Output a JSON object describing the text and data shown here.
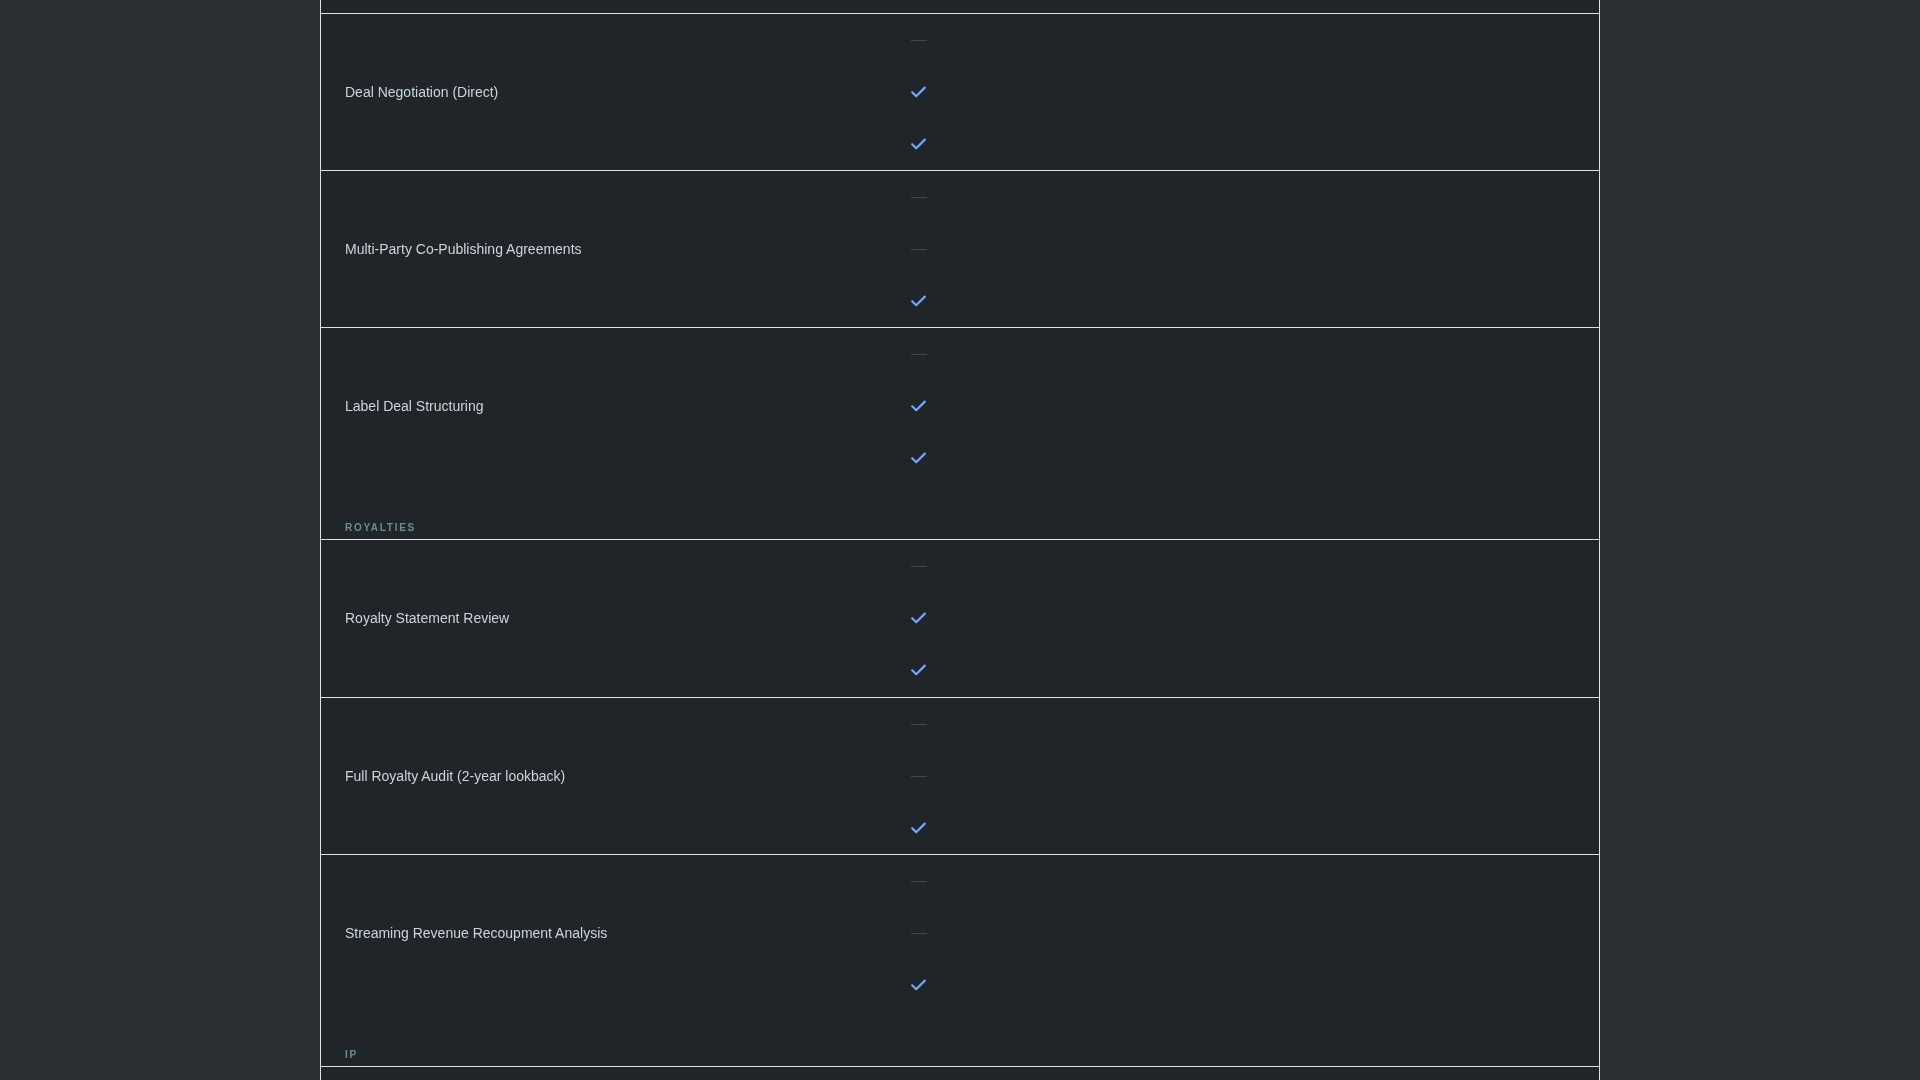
{
  "rows": [
    {
      "kind": "feature",
      "name": "Deal Negotiation (Direct)",
      "tiers": [
        {
          "included": false
        },
        {
          "included": true
        },
        {
          "included": true
        }
      ]
    },
    {
      "kind": "feature",
      "name": "Multi-Party Co-Publishing Agreements",
      "tiers": [
        {
          "included": false
        },
        {
          "included": false
        },
        {
          "included": true
        }
      ]
    },
    {
      "kind": "feature",
      "name": "Label Deal Structuring",
      "tiers": [
        {
          "included": false
        },
        {
          "included": true
        },
        {
          "included": true
        }
      ]
    },
    {
      "kind": "section",
      "title": "ROYALTIES"
    },
    {
      "kind": "feature",
      "name": "Royalty Statement Review",
      "tiers": [
        {
          "included": false
        },
        {
          "included": true
        },
        {
          "included": true
        }
      ]
    },
    {
      "kind": "feature",
      "name": "Full Royalty Audit (2-year lookback)",
      "tiers": [
        {
          "included": false
        },
        {
          "included": false
        },
        {
          "included": true
        }
      ]
    },
    {
      "kind": "feature",
      "name": "Streaming Revenue Recoupment Analysis",
      "tiers": [
        {
          "included": false
        },
        {
          "included": false
        },
        {
          "included": true
        }
      ]
    },
    {
      "kind": "section",
      "title": "IP"
    }
  ]
}
